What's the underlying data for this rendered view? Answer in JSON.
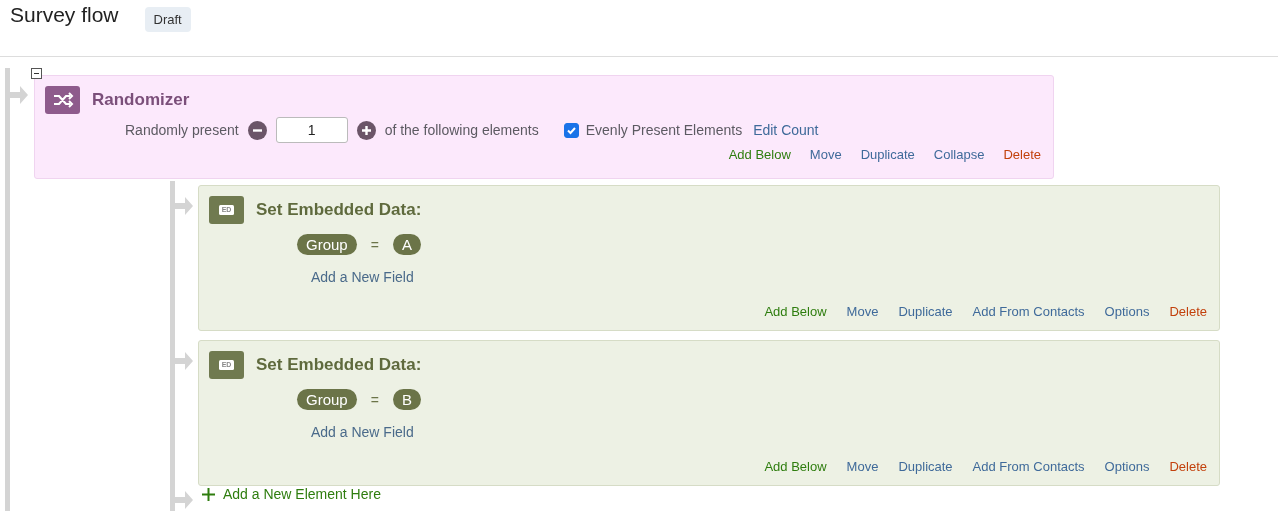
{
  "header": {
    "title": "Survey flow",
    "badge": "Draft"
  },
  "randomizer": {
    "title": "Randomizer",
    "collapsed": false,
    "label_before": "Randomly present",
    "count": "1",
    "label_after": "of the following elements",
    "evenly": {
      "label": "Evenly Present Elements",
      "checked": true
    },
    "edit_link": "Edit Count",
    "actions": [
      {
        "label": "Add Below",
        "kind": "add"
      },
      {
        "label": "Move",
        "kind": "link"
      },
      {
        "label": "Duplicate",
        "kind": "link"
      },
      {
        "label": "Collapse",
        "kind": "link"
      },
      {
        "label": "Delete",
        "kind": "delete"
      }
    ],
    "children": [
      {
        "title": "Set Embedded Data:",
        "badge": "ED",
        "fields": [
          {
            "name": "Group",
            "operator": "=",
            "value": "A"
          }
        ],
        "add_field": "Add a New Field",
        "actions": [
          {
            "label": "Add Below",
            "kind": "add"
          },
          {
            "label": "Move",
            "kind": "link"
          },
          {
            "label": "Duplicate",
            "kind": "link"
          },
          {
            "label": "Add From Contacts",
            "kind": "link"
          },
          {
            "label": "Options",
            "kind": "link"
          },
          {
            "label": "Delete",
            "kind": "delete"
          }
        ]
      },
      {
        "title": "Set Embedded Data:",
        "badge": "ED",
        "fields": [
          {
            "name": "Group",
            "operator": "=",
            "value": "B"
          }
        ],
        "add_field": "Add a New Field",
        "actions": [
          {
            "label": "Add Below",
            "kind": "add"
          },
          {
            "label": "Move",
            "kind": "link"
          },
          {
            "label": "Duplicate",
            "kind": "link"
          },
          {
            "label": "Add From Contacts",
            "kind": "link"
          },
          {
            "label": "Options",
            "kind": "link"
          },
          {
            "label": "Delete",
            "kind": "delete"
          }
        ]
      }
    ],
    "add_element": "Add a New Element Here"
  }
}
